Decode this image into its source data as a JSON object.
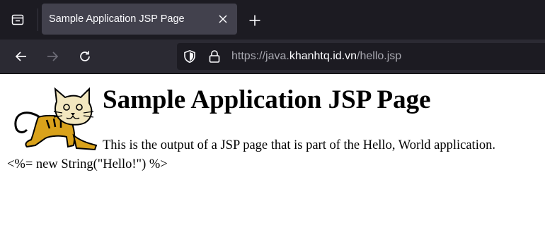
{
  "browser": {
    "tab": {
      "title": "Sample Application JSP Page"
    },
    "url": {
      "scheme_prefix": "https://java.",
      "host": "khanhtq.id.vn",
      "path": "/hello.jsp"
    }
  },
  "page": {
    "heading": "Sample Application JSP Page",
    "paragraph": "This is the output of a JSP page that is part of the Hello, World application.",
    "code_line": "<%= new String(\"Hello!\") %>"
  },
  "icons": {
    "tab_list": "tab-list-icon",
    "close_tab": "close-icon",
    "new_tab": "plus-icon",
    "back": "arrow-left-icon",
    "forward": "arrow-right-icon",
    "reload": "reload-icon",
    "tracking_protection": "shield-icon",
    "secure": "lock-icon",
    "logo": "tomcat-logo"
  },
  "colors": {
    "tabbar_bg": "#1c1b22",
    "active_tab_bg": "#42414d",
    "navbar_bg": "#2b2a33",
    "urlbar_bg": "#1c1b22",
    "logo_yellow": "#d9a21b"
  }
}
